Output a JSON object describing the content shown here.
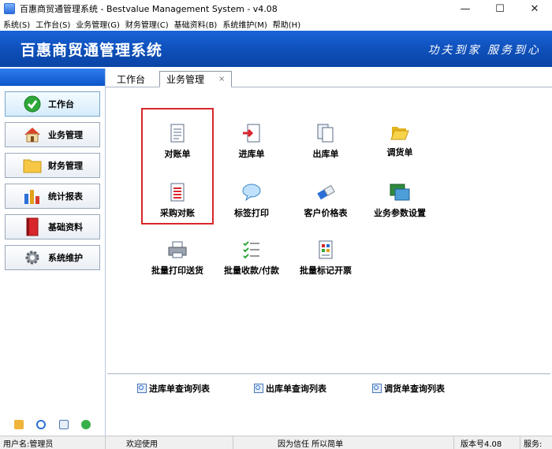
{
  "window": {
    "title": "百惠商贸通管理系统 - Bestvalue Management System - v4.08",
    "minimize": "—",
    "maximize": "☐",
    "close": "✕"
  },
  "menu": [
    "系统(S)",
    "工作台(S)",
    "业务管理(G)",
    "财务管理(C)",
    "基础资料(B)",
    "系统维护(M)",
    "帮助(H)"
  ],
  "banner": {
    "title": "百惠商贸通管理系统",
    "slogan": "功夫到家 服务到心"
  },
  "sidebar": {
    "items": [
      {
        "label": "工作台",
        "icon": "check-circle-icon",
        "active": true
      },
      {
        "label": "业务管理",
        "icon": "house-icon"
      },
      {
        "label": "财务管理",
        "icon": "folder-icon"
      },
      {
        "label": "统计报表",
        "icon": "bar-chart-icon"
      },
      {
        "label": "基础资料",
        "icon": "book-icon"
      },
      {
        "label": "系统维护",
        "icon": "gear-icon"
      }
    ]
  },
  "tabs": [
    {
      "label": "工作台"
    },
    {
      "label": "业务管理",
      "close": "×",
      "active": true
    }
  ],
  "functions": {
    "reconcile": "对账单",
    "stock_in": "进库单",
    "stock_out": "出库单",
    "transfer": "调货单",
    "purchase_reconcile": "采购对账",
    "label_print": "标签打印",
    "customer_price": "客户价格表",
    "business_params": "业务参数设置",
    "batch_print": "批量打印送货",
    "batch_payment": "批量收款/付款",
    "batch_invoice": "批量标记开票"
  },
  "queries": {
    "stock_in_list": "进库单查询列表",
    "stock_out_list": "出库单查询列表",
    "transfer_list": "调货单查询列表"
  },
  "status": {
    "user": "用户名:管理员",
    "welcome": "欢迎使用",
    "motto": "因为信任 所以简单",
    "version": "版本号4.08",
    "service": "服务:"
  },
  "colors": {
    "banner": "#0e4fb8",
    "highlight_box": "#d8262b"
  }
}
